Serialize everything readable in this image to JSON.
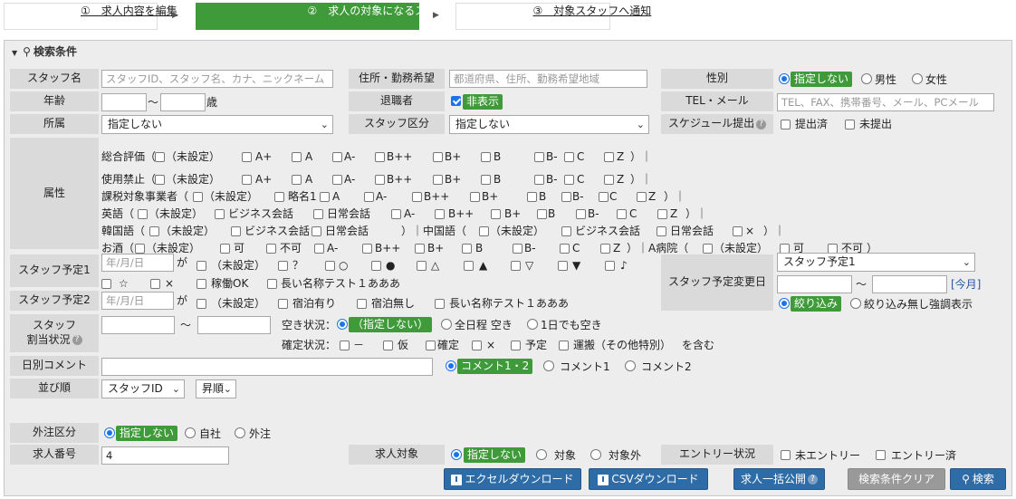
{
  "steps": [
    {
      "label": "①　求人内容を編集"
    },
    {
      "label": "②　求人の対象になるスタッフを選択"
    },
    {
      "label": "③　対象スタッフへ通知"
    }
  ],
  "panel": {
    "title": "検索条件"
  },
  "labels": {
    "staff_name": "スタッフ名",
    "address": "住所・勤務希望",
    "gender": "性別",
    "age": "年齢",
    "retired": "退職者",
    "tel": "TEL・メール",
    "affiliation": "所属",
    "staff_kubun": "スタッフ区分",
    "schedule": "スケジュール提出",
    "attributes": "属性",
    "plan1": "スタッフ予定1",
    "plan2": "スタッフ予定2",
    "plan_change": "スタッフ予定変更日",
    "assign1": "スタッフ",
    "assign2": "割当状況",
    "daily_comment": "日別コメント",
    "sort": "並び順",
    "outsource": "外注区分",
    "job_number": "求人番号",
    "job_target": "求人対象",
    "entry_status": "エントリー状況"
  },
  "fields": {
    "staff_name_ph": "スタッフID、スタッフ名、カナ、ニックネーム",
    "address_ph": "都道府県、住所、勤務希望地域",
    "tel_ph": "TEL、FAX、携帯番号、メール、PCメール",
    "age_sep": "〜",
    "age_unit": "歳",
    "date_ph": "年/月/日",
    "job_number": "4",
    "ga": "が",
    "tilde": "〜"
  },
  "gender": {
    "selected": "指定しない",
    "male": "男性",
    "female": "女性"
  },
  "retired": {
    "label": "非表示"
  },
  "selects": {
    "affiliation": "指定しない",
    "staff_kubun": "指定しない",
    "plan_change": "スタッフ予定1",
    "sort_key": "スタッフID",
    "sort_dir": "昇順"
  },
  "schedule": {
    "submitted": "提出済",
    "unsubmitted": "未提出"
  },
  "attr": {
    "r1": {
      "head": "総合評価（",
      "opts": [
        "（未設定）",
        "A+",
        "A",
        "A-",
        "B++",
        "B+",
        "B",
        "B-",
        "C",
        "Z"
      ],
      "tail": "）｜"
    },
    "r2": {
      "head": "使用禁止（",
      "opts": [
        "（未設定）",
        "A+",
        "A",
        "A-",
        "B++",
        "B+",
        "B",
        "B-",
        "C",
        "Z"
      ],
      "tail": "）｜"
    },
    "r3": {
      "head": "課税対象事業者（",
      "opts": [
        "（未設定）",
        "略名1",
        "A",
        "A-",
        "B++",
        "B+",
        "B",
        "B-",
        "C",
        "Z"
      ],
      "tail": "）｜"
    },
    "r4": {
      "head": "英語（",
      "opts": [
        "（未設定）",
        "ビジネス会話",
        "日常会話",
        "A-",
        "B++",
        "B+",
        "B",
        "B-",
        "C",
        "Z"
      ],
      "tail": "）｜"
    },
    "r5": {
      "head": "韓国語（",
      "opts": [
        "（未設定）",
        "ビジネス会話",
        "日常会話"
      ],
      "mid": "）｜中国語（",
      "opts2": [
        "（未設定）",
        "ビジネス会話",
        "日常会話",
        "×"
      ],
      "tail": "）｜"
    },
    "r6": {
      "head": "お酒（",
      "opts": [
        "（未設定）",
        "可",
        "不可",
        "A-",
        "B++",
        "B+",
        "B",
        "B-",
        "C",
        "Z"
      ],
      "mid": "）｜A病院（",
      "opts2": [
        "（未設定）",
        "可",
        "不可"
      ],
      "tail": "）"
    }
  },
  "plan1": {
    "opts": [
      "（未設定）",
      "？",
      "○",
      "●",
      "△",
      "▲",
      "▽",
      "▼",
      "♪",
      "☆",
      "×",
      "稼働OK",
      "長い名称テスト１あああ"
    ]
  },
  "plan2": {
    "opts": [
      "（未設定）",
      "宿泊有り",
      "宿泊無し",
      "長い名称テスト１あああ"
    ]
  },
  "plan_change": {
    "month": "[今月]",
    "narrow": "絞り込み",
    "emph": "絞り込み無し強調表示"
  },
  "assign": {
    "vacancy_label": "空き状況：",
    "vacancy_selected": "（指定しない）",
    "all_days": "全日程 空き",
    "one_day": "1日でも空き",
    "confirm_label": "確定状況：",
    "confirm_opts": [
      "－",
      "仮",
      "確定",
      "×",
      "予定",
      "運搬（その他特別）"
    ],
    "include": "を含む"
  },
  "comment": {
    "both": "コメント1・2",
    "c1": "コメント1",
    "c2": "コメント2"
  },
  "outsource": {
    "selected": "指定しない",
    "own": "自社",
    "out": "外注"
  },
  "job_target": {
    "selected": "指定しない",
    "target": "対象",
    "non": "対象外"
  },
  "entry": {
    "none": "未エントリー",
    "done": "エントリー済"
  },
  "buttons": {
    "excel": "エクセルダウンロード",
    "csv": "CSVダウンロード",
    "publish": "求人一括公開",
    "clear": "検索条件クリア",
    "search": "検索"
  },
  "colors": {
    "green": "#3f9a3a",
    "blue": "#2e6ca8",
    "label_bg": "#dadada",
    "panel_bg": "#ededed"
  }
}
